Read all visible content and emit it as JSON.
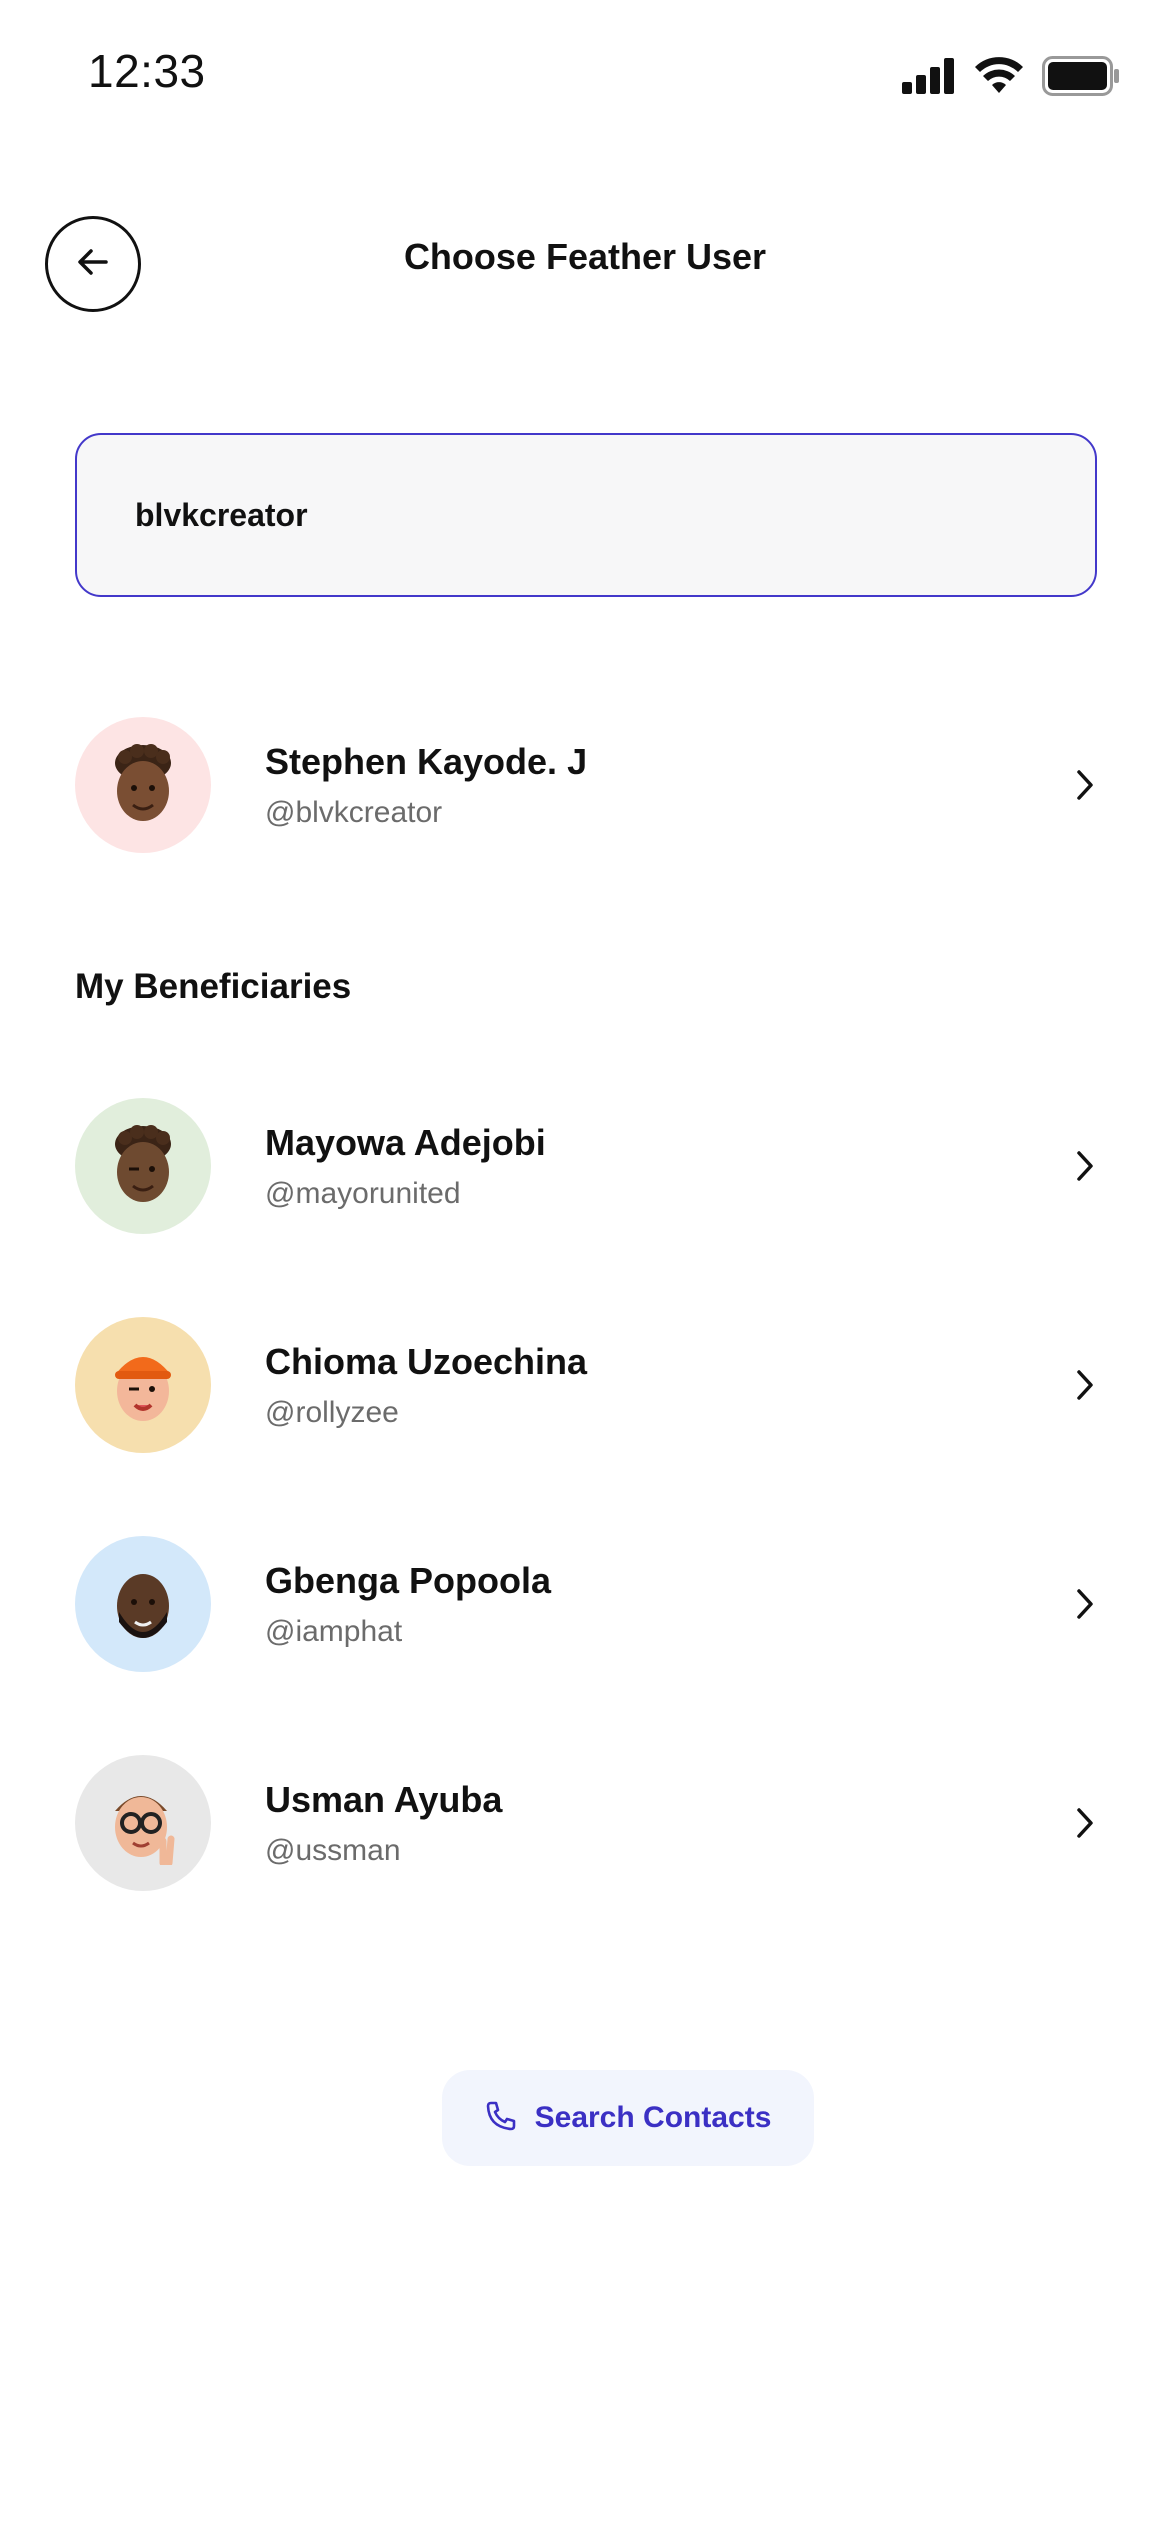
{
  "status_bar": {
    "time": "12:33",
    "icons": [
      "cellular-signal-icon",
      "wifi-icon",
      "battery-icon"
    ]
  },
  "header": {
    "back_icon": "arrow-left-icon",
    "title": "Choose Feather User"
  },
  "search": {
    "value": "blvkcreator",
    "accent_color": "#4338ca"
  },
  "search_result": {
    "name": "Stephen Kayode. J",
    "handle": "@blvkcreator",
    "avatar_bg": "#fde4e4",
    "avatar_icon": "memoji-avatar-icon"
  },
  "beneficiaries": {
    "title": "My Beneficiaries",
    "items": [
      {
        "name": "Mayowa Adejobi",
        "handle": "@mayorunited",
        "avatar_bg": "#e1eedc"
      },
      {
        "name": "Chioma Uzoechina",
        "handle": "@rollyzee",
        "avatar_bg": "#f6dfae"
      },
      {
        "name": "Gbenga Popoola",
        "handle": "@iamphat",
        "avatar_bg": "#d3e8fa"
      },
      {
        "name": "Usman Ayuba",
        "handle": "@ussman",
        "avatar_bg": "#e8e8e8"
      }
    ]
  },
  "contacts_button": {
    "label": "Search Contacts",
    "icon": "phone-icon",
    "text_color": "#3b30c4"
  }
}
